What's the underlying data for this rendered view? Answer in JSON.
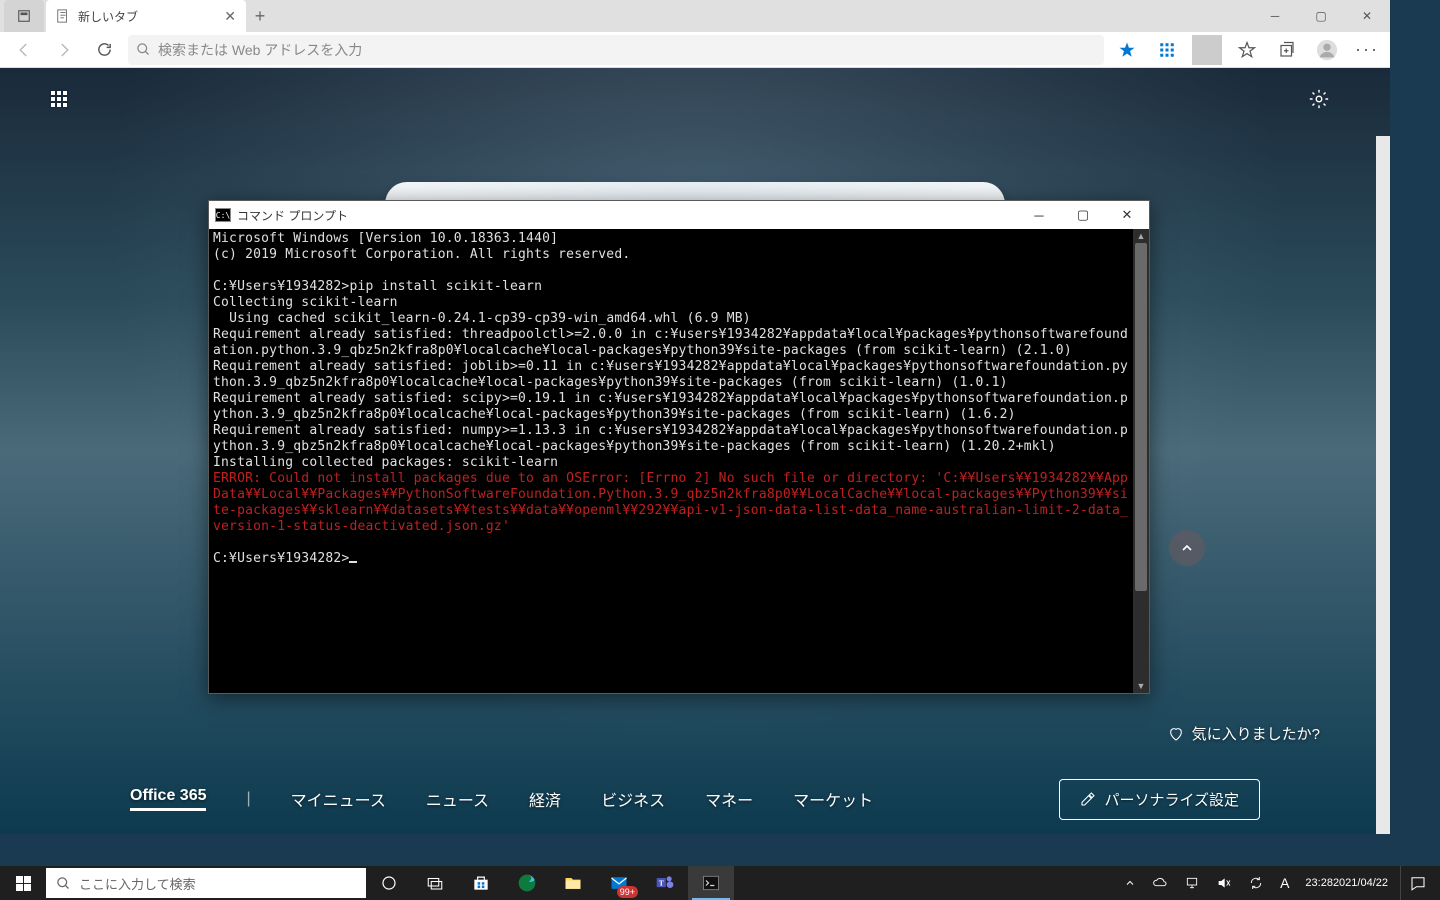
{
  "browser": {
    "tab_title": "新しいタブ",
    "search_placeholder": "検索または Web アドレスを入力",
    "newtab": {
      "like_prompt": "気に入りましたか?",
      "personalize_label": "パーソナライズ設定",
      "nav": [
        "Office 365",
        "マイニュース",
        "ニュース",
        "経済",
        "ビジネス",
        "マネー",
        "マーケット"
      ]
    }
  },
  "cmd": {
    "title": "コマンド プロンプト",
    "lines_plain": "Microsoft Windows [Version 10.0.18363.1440]\n(c) 2019 Microsoft Corporation. All rights reserved.\n\nC:¥Users¥1934282>pip install scikit-learn\nCollecting scikit-learn\n  Using cached scikit_learn-0.24.1-cp39-cp39-win_amd64.whl (6.9 MB)\nRequirement already satisfied: threadpoolctl>=2.0.0 in c:¥users¥1934282¥appdata¥local¥packages¥pythonsoftwarefoundation.python.3.9_qbz5n2kfra8p0¥localcache¥local-packages¥python39¥site-packages (from scikit-learn) (2.1.0)\nRequirement already satisfied: joblib>=0.11 in c:¥users¥1934282¥appdata¥local¥packages¥pythonsoftwarefoundation.python.3.9_qbz5n2kfra8p0¥localcache¥local-packages¥python39¥site-packages (from scikit-learn) (1.0.1)\nRequirement already satisfied: scipy>=0.19.1 in c:¥users¥1934282¥appdata¥local¥packages¥pythonsoftwarefoundation.python.3.9_qbz5n2kfra8p0¥localcache¥local-packages¥python39¥site-packages (from scikit-learn) (1.6.2)\nRequirement already satisfied: numpy>=1.13.3 in c:¥users¥1934282¥appdata¥local¥packages¥pythonsoftwarefoundation.python.3.9_qbz5n2kfra8p0¥localcache¥local-packages¥python39¥site-packages (from scikit-learn) (1.20.2+mkl)\nInstalling collected packages: scikit-learn",
    "lines_error": "ERROR: Could not install packages due to an OSError: [Errno 2] No such file or directory: 'C:¥¥Users¥¥1934282¥¥AppData¥¥Local¥¥Packages¥¥PythonSoftwareFoundation.Python.3.9_qbz5n2kfra8p0¥¥LocalCache¥¥local-packages¥¥Python39¥¥site-packages¥¥sklearn¥¥datasets¥¥tests¥¥data¥¥openml¥¥292¥¥api-v1-json-data-list-data_name-australian-limit-2-data_version-1-status-deactivated.json.gz'",
    "prompt_after": "C:¥Users¥1934282>"
  },
  "taskbar": {
    "search_placeholder": "ここに入力して検索",
    "teams_badge": "99+",
    "time": "23:28",
    "date": "2021/04/22",
    "ime_a": "A"
  }
}
